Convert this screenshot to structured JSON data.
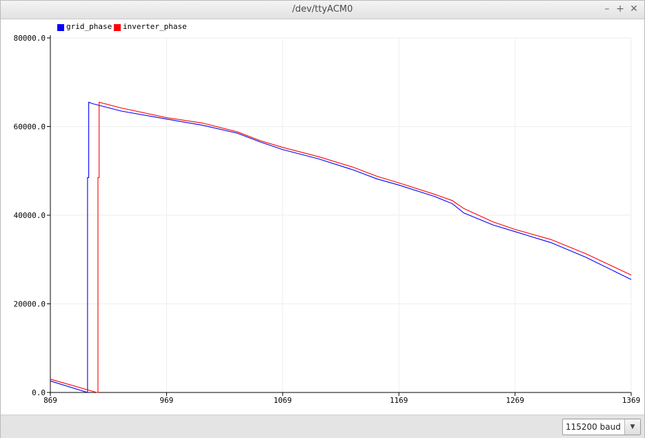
{
  "window": {
    "title": "/dev/ttyACM0",
    "minimize_icon": "minimize-icon",
    "maximize_icon": "maximize-icon",
    "close_icon": "close-icon",
    "minimize_glyph": "–",
    "maximize_glyph": "+",
    "close_glyph": "✕"
  },
  "bottom": {
    "baud": "115200 baud",
    "dropdown_icon": "chevron-down-icon",
    "dropdown_glyph": "▼"
  },
  "chart_data": {
    "type": "line",
    "title": "",
    "xlabel": "",
    "ylabel": "",
    "xlim": [
      869,
      1369
    ],
    "ylim": [
      0,
      80000
    ],
    "x_ticks": [
      869,
      969,
      1069,
      1169,
      1269,
      1369
    ],
    "y_ticks": [
      0,
      20000,
      40000,
      60000,
      80000
    ],
    "y_tick_labels": [
      "0.0",
      "20000.0",
      "40000.0",
      "60000.0",
      "80000.0"
    ],
    "grid": true,
    "legend_position": "top-left",
    "series": [
      {
        "name": "grid_phase",
        "color": "#0000ff",
        "points": [
          [
            869,
            2600
          ],
          [
            901,
            0
          ],
          [
            901,
            48500
          ],
          [
            902,
            48500
          ],
          [
            902,
            65500
          ],
          [
            905,
            65200
          ],
          [
            930,
            63500
          ],
          [
            969,
            61700
          ],
          [
            1000,
            60300
          ],
          [
            1030,
            58500
          ],
          [
            1050,
            56500
          ],
          [
            1069,
            54800
          ],
          [
            1100,
            52700
          ],
          [
            1130,
            50200
          ],
          [
            1150,
            48200
          ],
          [
            1169,
            46800
          ],
          [
            1200,
            44200
          ],
          [
            1215,
            42600
          ],
          [
            1225,
            40500
          ],
          [
            1250,
            37800
          ],
          [
            1269,
            36300
          ],
          [
            1300,
            33800
          ],
          [
            1330,
            30500
          ],
          [
            1369,
            25500
          ]
        ]
      },
      {
        "name": "inverter_phase",
        "color": "#ff0000",
        "points": [
          [
            869,
            3000
          ],
          [
            909,
            0
          ],
          [
            910,
            0
          ],
          [
            910,
            48500
          ],
          [
            911,
            48500
          ],
          [
            911,
            65500
          ],
          [
            930,
            64200
          ],
          [
            969,
            62000
          ],
          [
            1000,
            60800
          ],
          [
            1030,
            58800
          ],
          [
            1050,
            56800
          ],
          [
            1069,
            55300
          ],
          [
            1100,
            53200
          ],
          [
            1130,
            50800
          ],
          [
            1150,
            48800
          ],
          [
            1169,
            47300
          ],
          [
            1200,
            44700
          ],
          [
            1215,
            43300
          ],
          [
            1225,
            41500
          ],
          [
            1250,
            38500
          ],
          [
            1269,
            36800
          ],
          [
            1300,
            34500
          ],
          [
            1330,
            31300
          ],
          [
            1369,
            26500
          ]
        ]
      }
    ]
  }
}
